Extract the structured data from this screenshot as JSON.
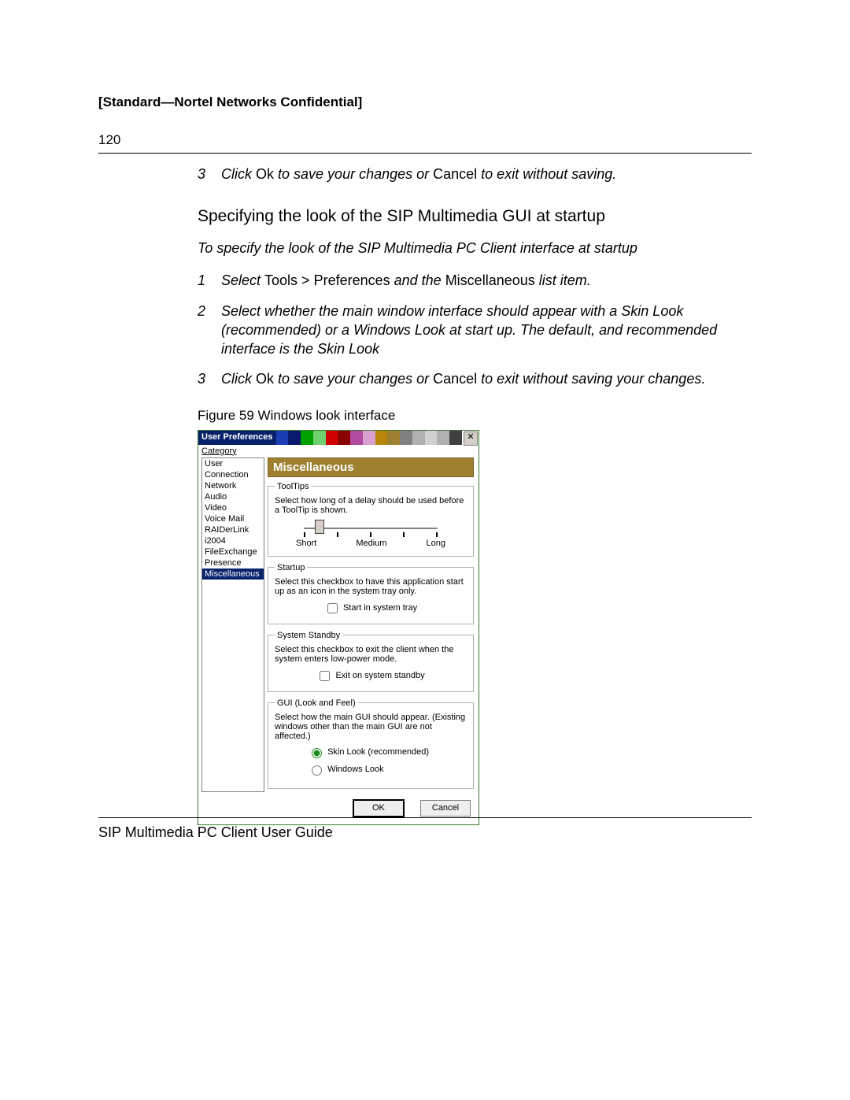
{
  "header": {
    "confidential": "[Standard—Nortel Networks Confidential]",
    "page_number": "120"
  },
  "steps_a": {
    "s3": {
      "num": "3",
      "t1": "Click ",
      "ok": "Ok",
      "t2": " to save your changes or ",
      "cancel": "Cancel",
      "t3": " to exit without saving."
    }
  },
  "section_title": "Specifying the look of the SIP Multimedia GUI at startup",
  "subheading": "To specify the look of the SIP Multimedia PC Client interface at startup",
  "steps_b": {
    "s1": {
      "num": "1",
      "t1": "Select ",
      "menu": "Tools > Preferences",
      "t2": " and the ",
      "item": "Miscellaneous",
      "t3": " list item."
    },
    "s2": {
      "num": "2",
      "text": "Select whether the main window interface should appear with a Skin Look (recommended) or a Windows Look at start up. The default, and recommended interface is the Skin Look"
    },
    "s3": {
      "num": "3",
      "t1": "Click ",
      "ok": "Ok",
      "t2": " to save your changes or ",
      "cancel": "Cancel",
      "t3": " to exit without saving your changes."
    }
  },
  "figure_caption": "Figure 59    Windows look interface",
  "dialog": {
    "title": "User Preferences",
    "category_label": "Category",
    "categories": [
      "User",
      "Connection",
      "Network",
      "Audio",
      "Video",
      "Voice Mail",
      "RAIDerLink",
      "i2004",
      "FileExchange",
      "Presence",
      "Miscellaneous"
    ],
    "selected_category": "Miscellaneous",
    "panel_title": "Miscellaneous",
    "tooltips": {
      "legend": "ToolTips",
      "desc": "Select how long of a delay should be used before a ToolTip is shown.",
      "short": "Short",
      "medium": "Medium",
      "long": "Long"
    },
    "startup": {
      "legend": "Startup",
      "desc": "Select this checkbox to have this application start up as an icon in the system tray only.",
      "cb": "Start in system tray"
    },
    "standby": {
      "legend": "System Standby",
      "desc": "Select this checkbox to exit the client when the system enters low-power mode.",
      "cb": "Exit on system standby"
    },
    "gui": {
      "legend": "GUI (Look and Feel)",
      "desc": "Select how the main GUI should appear. (Existing windows other than the main GUI are not affected.)",
      "opt1": "Skin Look (recommended)",
      "opt2": "Windows Look"
    },
    "ok": "OK",
    "cancel": "Cancel",
    "stripe_colors": [
      "#1b3fb3",
      "#0a1a6e",
      "#00a000",
      "#6fd06f",
      "#d00000",
      "#8b0000",
      "#b04aa0",
      "#d9a0d0",
      "#b8860b",
      "#9f8030",
      "#808080",
      "#b0b0b0",
      "#d0d0d0",
      "#b0b0b0",
      "#404040"
    ]
  },
  "footer": "SIP Multimedia PC Client User Guide"
}
